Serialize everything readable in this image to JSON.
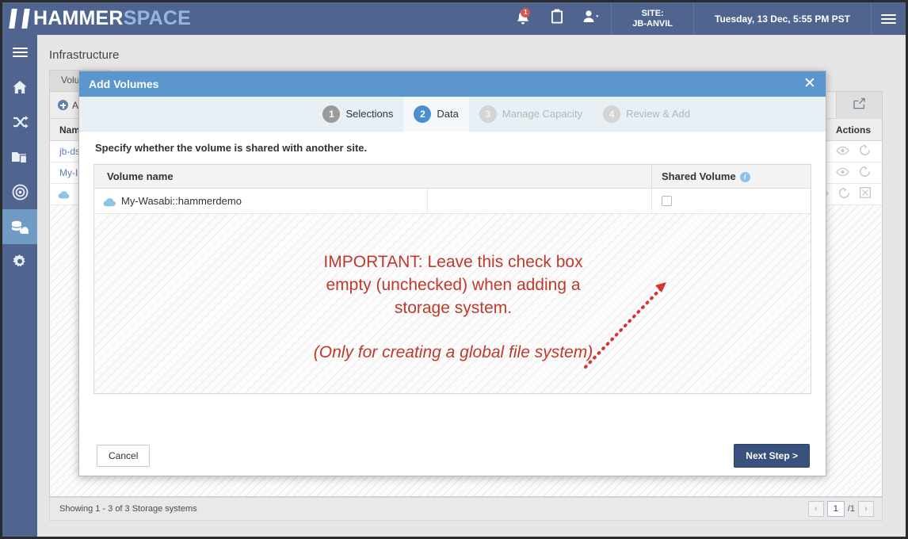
{
  "header": {
    "brand_primary": "HAMMER",
    "brand_secondary": "SPACE",
    "notification_badge": "1",
    "site_label": "SITE:",
    "site_value": "JB-ANVIL",
    "datetime": "Tuesday, 13 Dec, 5:55 PM PST",
    "icons": {
      "bell": "bell-icon",
      "clipboard": "clipboard-icon",
      "user": "user-icon",
      "menu": "hamburger-menu-icon"
    }
  },
  "sidebar": {
    "items": [
      {
        "name": "menu-toggle",
        "icon": "hamburger-menu-icon",
        "active": false
      },
      {
        "name": "home",
        "icon": "home-icon",
        "active": false
      },
      {
        "name": "objectives",
        "icon": "shuffle-arrows-icon",
        "active": false
      },
      {
        "name": "shares",
        "icon": "folder-files-icon",
        "active": false
      },
      {
        "name": "targets",
        "icon": "concentric-circles-icon",
        "active": false
      },
      {
        "name": "infrastructure",
        "icon": "storage-cloud-icon",
        "active": true
      },
      {
        "name": "settings",
        "icon": "gear-icon",
        "active": false
      }
    ]
  },
  "page": {
    "title": "Infrastructure",
    "tab_label": "Volumes",
    "toolbar": {
      "add_label": "Add",
      "export_icon": "export-icon"
    },
    "table": {
      "col_name": "Name",
      "col_actions": "Actions",
      "rows": [
        {
          "name": "jb-ds",
          "cloud": false
        },
        {
          "name": "My-Is",
          "cloud": false
        },
        {
          "name": "",
          "cloud": true
        }
      ]
    },
    "status": "Showing 1 - 3 of 3 Storage systems",
    "pager": {
      "prev": "‹",
      "page": "1",
      "total": "/1",
      "next": "›"
    }
  },
  "modal": {
    "title": "Add Volumes",
    "close_icon": "close-icon",
    "steps": [
      {
        "num": "1",
        "label": "Selections",
        "state": "done"
      },
      {
        "num": "2",
        "label": "Data",
        "state": "current"
      },
      {
        "num": "3",
        "label": "Manage Capacity",
        "state": "disabled"
      },
      {
        "num": "4",
        "label": "Review & Add",
        "state": "disabled"
      }
    ],
    "instruction": "Specify whether the volume is shared with another site.",
    "table": {
      "col_volume_name": "Volume name",
      "col_shared_volume": "Shared Volume",
      "info_icon": "info-icon",
      "row": {
        "volume_name": "My-Wasabi::hammerdemo",
        "cloud_icon": "cloud-icon",
        "shared_checked": false
      }
    },
    "annotation": {
      "line1": "IMPORTANT: Leave this check box",
      "line2": "empty (unchecked) when adding a",
      "line3": "storage system.",
      "line4": "(Only for creating a global file system)",
      "color": "#c0392b",
      "arrow": "dotted-arrow-pointing-to-checkbox"
    },
    "buttons": {
      "cancel": "Cancel",
      "next": "Next Step >"
    }
  },
  "colors": {
    "brand_bar": "#4f6590",
    "modal_header": "#5b97cd",
    "accent_step": "#4a90d0",
    "primary_button": "#39517d",
    "annotation_red": "#c0392b"
  }
}
